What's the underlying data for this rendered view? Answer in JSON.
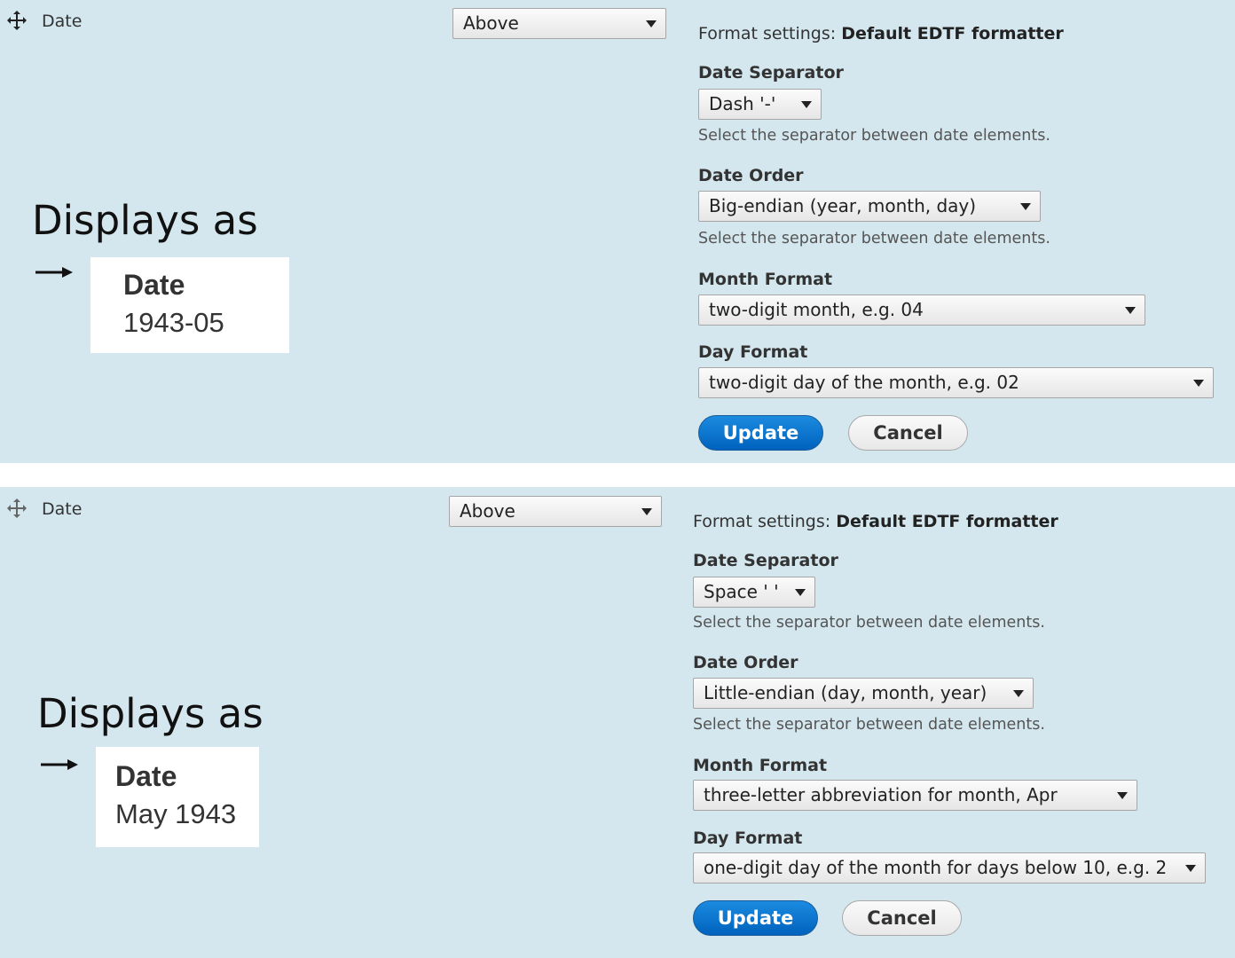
{
  "panels": [
    {
      "field_label": "Date",
      "label_display": "Above",
      "annotation": "Displays as",
      "preview": {
        "label": "Date",
        "value": "1943-05"
      },
      "format": {
        "prefix": "Format settings:",
        "formatter": "Default EDTF formatter",
        "date_separator": {
          "label": "Date Separator",
          "value": "Dash '-'",
          "description": "Select the separator between date elements."
        },
        "date_order": {
          "label": "Date Order",
          "value": "Big-endian (year, month, day)",
          "description": "Select the separator between date elements."
        },
        "month_format": {
          "label": "Month Format",
          "value": "two-digit month, e.g. 04"
        },
        "day_format": {
          "label": "Day Format",
          "value": "two-digit day of the month, e.g. 02"
        }
      },
      "buttons": {
        "update": "Update",
        "cancel": "Cancel"
      }
    },
    {
      "field_label": "Date",
      "label_display": "Above",
      "annotation": "Displays as",
      "preview": {
        "label": "Date",
        "value": "May 1943"
      },
      "format": {
        "prefix": "Format settings:",
        "formatter": "Default EDTF formatter",
        "date_separator": {
          "label": "Date Separator",
          "value": "Space ' '",
          "description": "Select the separator between date elements."
        },
        "date_order": {
          "label": "Date Order",
          "value": "Little-endian (day, month, year)",
          "description": "Select the separator between date elements."
        },
        "month_format": {
          "label": "Month Format",
          "value": "three-letter abbreviation for month, Apr"
        },
        "day_format": {
          "label": "Day Format",
          "value": "one-digit day of the month for days below 10, e.g. 2"
        }
      },
      "buttons": {
        "update": "Update",
        "cancel": "Cancel"
      }
    }
  ],
  "colors": {
    "panel_bg": "#d4e7ee",
    "primary": "#0071c5"
  },
  "icons": {
    "drag": "move-cross-icon",
    "select": "caret-down-icon",
    "annotation": "arrow-right-icon"
  }
}
